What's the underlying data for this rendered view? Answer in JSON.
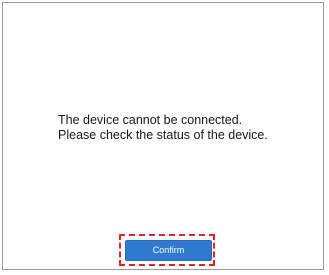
{
  "dialog": {
    "message_lines": [
      "The device cannot be connected.",
      "Please check the status of the device."
    ],
    "confirm_label": "Confirm"
  },
  "colors": {
    "confirm_button_bg": "#2f7ad0",
    "highlight_border": "#e0242b"
  }
}
